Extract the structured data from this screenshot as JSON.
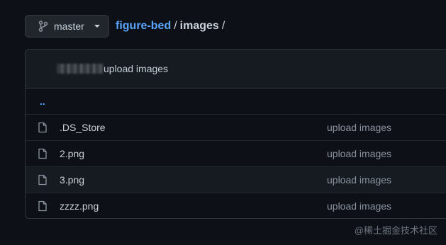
{
  "branch": {
    "name": "master",
    "icon": "git-branch-icon"
  },
  "breadcrumb": {
    "repo": "figure-bed",
    "separator": "/",
    "folder": "images",
    "trailing": "/"
  },
  "latest_commit": {
    "message": "upload images"
  },
  "parent_dir": {
    "label": ".."
  },
  "files": [
    {
      "name": ".DS_Store",
      "commit": "upload images",
      "icon": "file-icon"
    },
    {
      "name": "2.png",
      "commit": "upload images",
      "icon": "file-icon"
    },
    {
      "name": "3.png",
      "commit": "upload images",
      "icon": "file-icon"
    },
    {
      "name": "zzzz.png",
      "commit": "upload images",
      "icon": "file-icon"
    }
  ],
  "watermark": {
    "text": "@稀土掘金技术社区"
  },
  "colors": {
    "background": "#0d1117",
    "link": "#58a6ff",
    "muted": "#8b949e",
    "border": "#30363d"
  }
}
